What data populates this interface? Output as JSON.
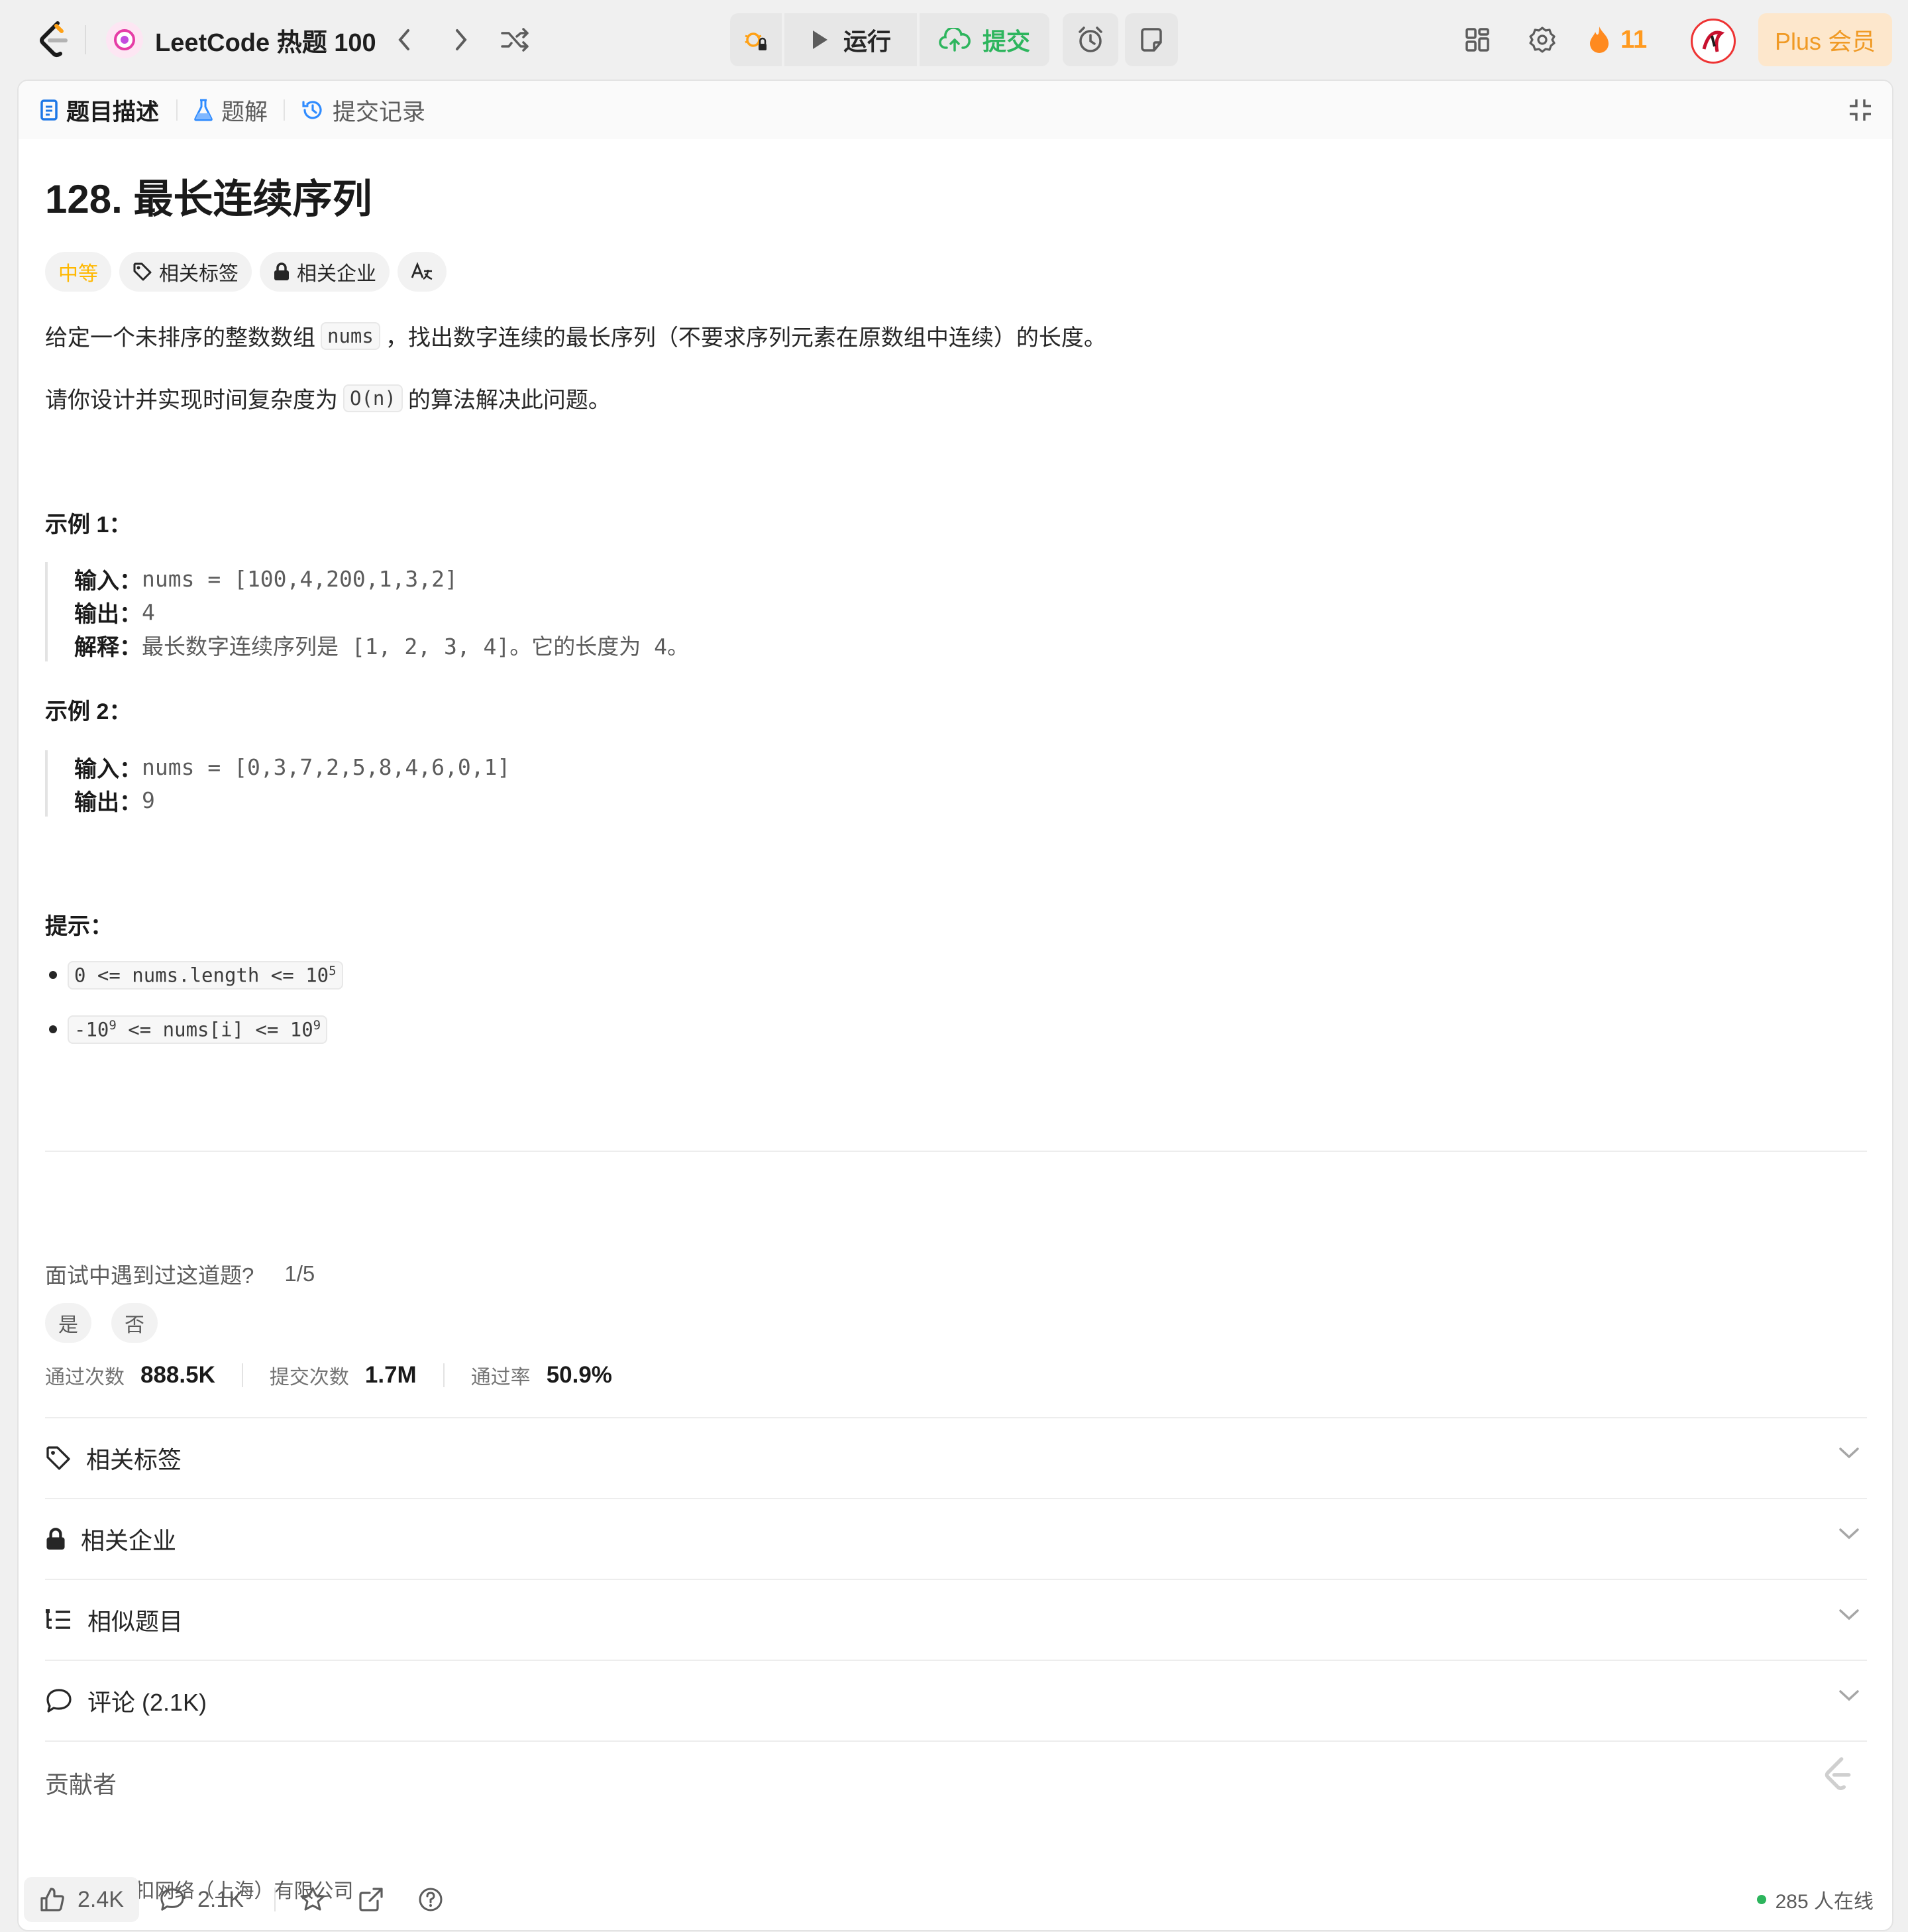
{
  "topbar": {
    "list_title": "LeetCode 热题 100",
    "run_label": "运行",
    "submit_label": "提交",
    "streak_count": "11",
    "plus_label": "Plus 会员"
  },
  "tabs": [
    {
      "label": "题目描述",
      "icon": "document-icon",
      "active": true
    },
    {
      "label": "题解",
      "icon": "flask-icon",
      "active": false
    },
    {
      "label": "提交记录",
      "icon": "history-icon",
      "active": false
    }
  ],
  "problem": {
    "title": "128. 最长连续序列",
    "difficulty": "中等",
    "tag_badge": "相关标签",
    "company_badge": "相关企业",
    "translate_badge": "A͢",
    "desc1_pre": "给定一个未排序的整数数组",
    "desc1_code": "nums",
    "desc1_post": "，找出数字连续的最长序列（不要求序列元素在原数组中连续）的长度。",
    "desc2_pre": "请你设计并实现时间复杂度为",
    "desc2_code": "O(n)",
    "desc2_post": "的算法解决此问题。"
  },
  "examples": [
    {
      "heading": "示例 1：",
      "input_label": "输入：",
      "input": "nums = [100,4,200,1,3,2]",
      "output_label": "输出：",
      "output": "4",
      "explain_label": "解释：",
      "explain": "最长数字连续序列是 [1, 2, 3, 4]。它的长度为 4。"
    },
    {
      "heading": "示例 2：",
      "input_label": "输入：",
      "input": "nums = [0,3,7,2,5,8,4,6,0,1]",
      "output_label": "输出：",
      "output": "9"
    }
  ],
  "hints": {
    "heading": "提示：",
    "h1_pre": "0 <= nums.length <= 10",
    "h1_sup": "5",
    "h2_a": "-10",
    "h2_sup1": "9",
    "h2_b": " <= nums[i] <= 10",
    "h2_sup2": "9"
  },
  "interview": {
    "question": "面试中遇到过这道题?",
    "progress": "1/5",
    "yes": "是",
    "no": "否"
  },
  "stats": {
    "accepted_label": "通过次数",
    "accepted": "888.5K",
    "submissions_label": "提交次数",
    "submissions": "1.7M",
    "rate_label": "通过率",
    "rate": "50.9%"
  },
  "accordions": {
    "tags": "相关标签",
    "companies": "相关企业",
    "similar": "相似题目",
    "comments": "评论 (2.1K)"
  },
  "contributors_label": "贡献者",
  "copyright": "© 2025 领扣网络（上海）有限公司",
  "bottombar": {
    "likes": "2.4K",
    "comments": "2.1K",
    "online": "285 人在线"
  },
  "colors": {
    "accent_green": "#2db55d",
    "difficulty_medium": "#ffb800",
    "streak_orange": "#ff9a1f",
    "plus_bg": "#fde7cc"
  }
}
